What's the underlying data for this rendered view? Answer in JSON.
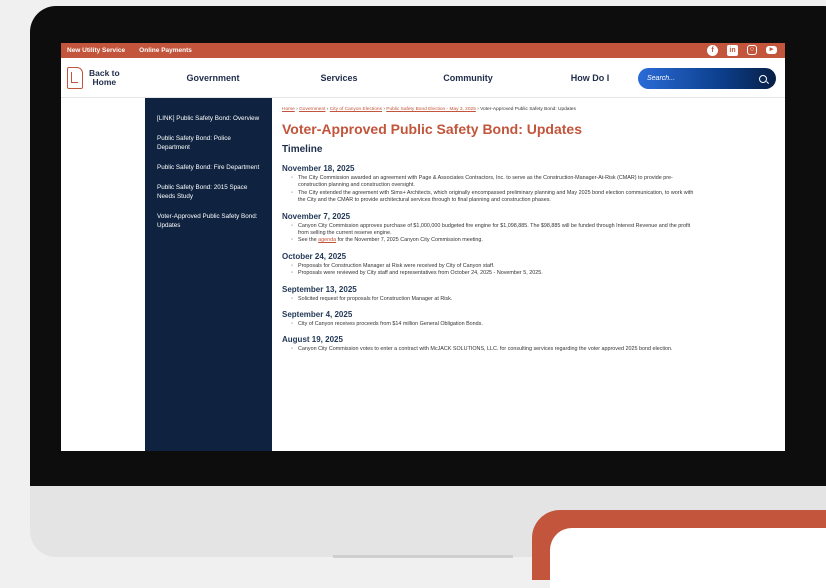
{
  "topbar": {
    "links": [
      "New Utility Service",
      "Online Payments"
    ],
    "social_icons": [
      "facebook-icon",
      "linkedin-icon",
      "instagram-icon",
      "youtube-icon"
    ]
  },
  "nav": {
    "home_line1": "Back to",
    "home_line2": "Home",
    "items": [
      "Government",
      "Services",
      "Community",
      "How Do I"
    ],
    "search_placeholder": "Search..."
  },
  "sidenav": {
    "items": [
      "[LINK] Public Safety Bond: Overview",
      "Public Safety Bond: Police Department",
      "Public Safety Bond: Fire Department",
      "Public Safety Bond: 2015 Space Needs Study",
      "Voter-Approved Public Safety Bond: Updates"
    ]
  },
  "breadcrumb": {
    "crumbs": [
      "Home",
      "Government",
      "City of Canyon Elections",
      "Public Safety Bond Election - May 3, 2025"
    ],
    "current": "Voter-Approved Public Safety Bond: Updates"
  },
  "page": {
    "title": "Voter-Approved Public Safety Bond: Updates",
    "section": "Timeline"
  },
  "timeline": [
    {
      "date": "November 18, 2025",
      "items": [
        "The City Commission awarded an agreement with Page & Associates Contractors, Inc. to serve as the Construction-Manager-At-Risk (CMAR) to provide pre-construction planning and construction oversight.",
        "The City extended the agreement with Sims+ Architects, which originally encompassed preliminary planning and May 2025 bond election communication, to work with the City and the CMAR to provide architectural services through to final planning and construction phases."
      ]
    },
    {
      "date": "November 7, 2025",
      "items": [
        "Canyon City Commission approves purchase of $1,000,000 budgeted fire engine for $1,098,885. The $98,885 will be funded through Interest Revenue and the profit from selling the current reserve engine."
      ],
      "agenda_item": {
        "before": "See the ",
        "link": "agenda",
        "after": " for the November 7, 2025 Canyon City Commission meeting."
      }
    },
    {
      "date": "October 24, 2025",
      "items": [
        "Proposals for Construction Manager at Risk were received by City of Canyon staff.",
        "Proposals were reviewed by City staff and representatives from October 24, 2025 - November 5, 2025."
      ]
    },
    {
      "date": "September 13, 2025",
      "items": [
        "Solicited request for proposals for Construction Manager at Risk."
      ]
    },
    {
      "date": "September 4, 2025",
      "items": [
        "City of Canyon receives proceeds from $14 million General Obligation Bonds."
      ]
    },
    {
      "date": "August 19, 2025",
      "items": [
        "Canyon City Commission votes to enter a contract with McJACK SOLUTIONS, LLC. for consulting services regarding the voter approved 2025 bond election."
      ]
    }
  ],
  "colors": {
    "accent": "#c2553b",
    "navy": "#0f2340",
    "heading": "#1f2d4a"
  }
}
